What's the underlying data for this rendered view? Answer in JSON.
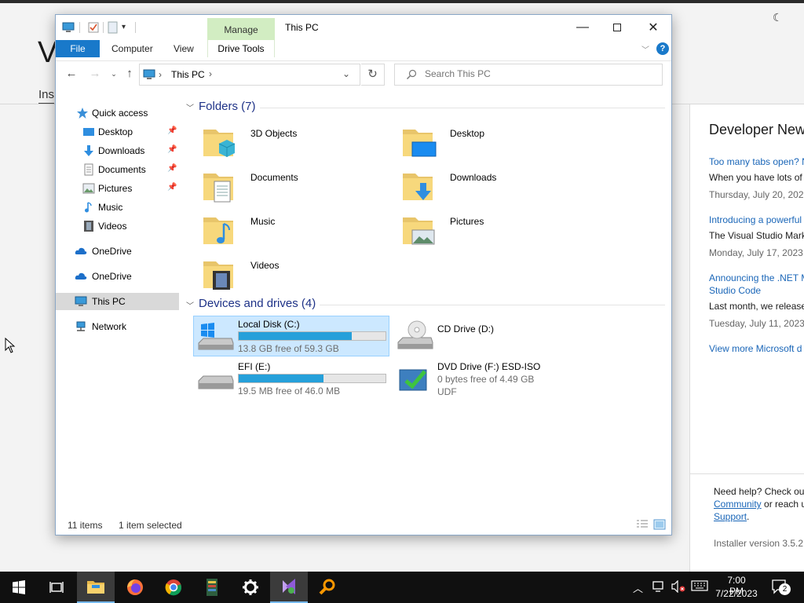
{
  "background_app": {
    "title_partial": "V",
    "tab_partial": "Ins",
    "news": {
      "heading": "Developer New",
      "items": [
        {
          "link": "Too many tabs open? N",
          "text": "When you have lots of",
          "date": "Thursday, July 20, 2023"
        },
        {
          "link": "Introducing a powerful",
          "text": "The Visual Studio Mark",
          "date": "Monday, July 17, 2023"
        },
        {
          "link": "Announcing the .NET M",
          "link2": "Studio Code",
          "text": "Last month, we release",
          "date": "Tuesday, July 11, 2023"
        }
      ],
      "view_more": "View more Microsoft d"
    },
    "help": {
      "line1": "Need help? Check out",
      "community_link": "Community",
      "line2_rest": " or reach u",
      "support_link": "Support",
      "support_suffix": "."
    },
    "installer_version": "Installer version 3.5.2"
  },
  "explorer": {
    "title": "This PC",
    "manage_tab": "Manage",
    "ribbon_tabs": {
      "file": "File",
      "computer": "Computer",
      "view": "View",
      "drive_tools": "Drive Tools"
    },
    "help_label": "?",
    "address": {
      "path": "This PC",
      "separator": "›"
    },
    "search": {
      "placeholder": "Search This PC"
    },
    "nav": {
      "quick_access": "Quick access",
      "desktop": "Desktop",
      "downloads": "Downloads",
      "documents": "Documents",
      "pictures": "Pictures",
      "music": "Music",
      "videos": "Videos",
      "onedrive1": "OneDrive",
      "onedrive2": "OneDrive",
      "this_pc": "This PC",
      "network": "Network"
    },
    "folders_group": "Folders (7)",
    "folders": {
      "objects3d": "3D Objects",
      "desktop": "Desktop",
      "documents": "Documents",
      "downloads": "Downloads",
      "music": "Music",
      "pictures": "Pictures",
      "videos": "Videos"
    },
    "drives_group": "Devices and drives (4)",
    "drives": {
      "c": {
        "name": "Local Disk (C:)",
        "free": "13.8 GB free of 59.3 GB",
        "used_fraction": 0.77
      },
      "d": {
        "name": "CD Drive (D:)"
      },
      "e": {
        "name": "EFI (E:)",
        "free": "19.5 MB free of 46.0 MB",
        "used_fraction": 0.58
      },
      "f": {
        "name": "DVD Drive (F:) ESD-ISO",
        "free": "0 bytes free of 4.49 GB",
        "fs": "UDF"
      }
    },
    "status": {
      "items": "11 items",
      "selected": "1 item selected"
    }
  },
  "taskbar": {
    "time": "7:00 PM",
    "date": "7/22/2023",
    "notification_count": "2"
  },
  "colors": {
    "accent": "#1979ca",
    "drive_bar": "#26a0da",
    "selection": "#cce8ff",
    "link": "#1a66b8"
  }
}
